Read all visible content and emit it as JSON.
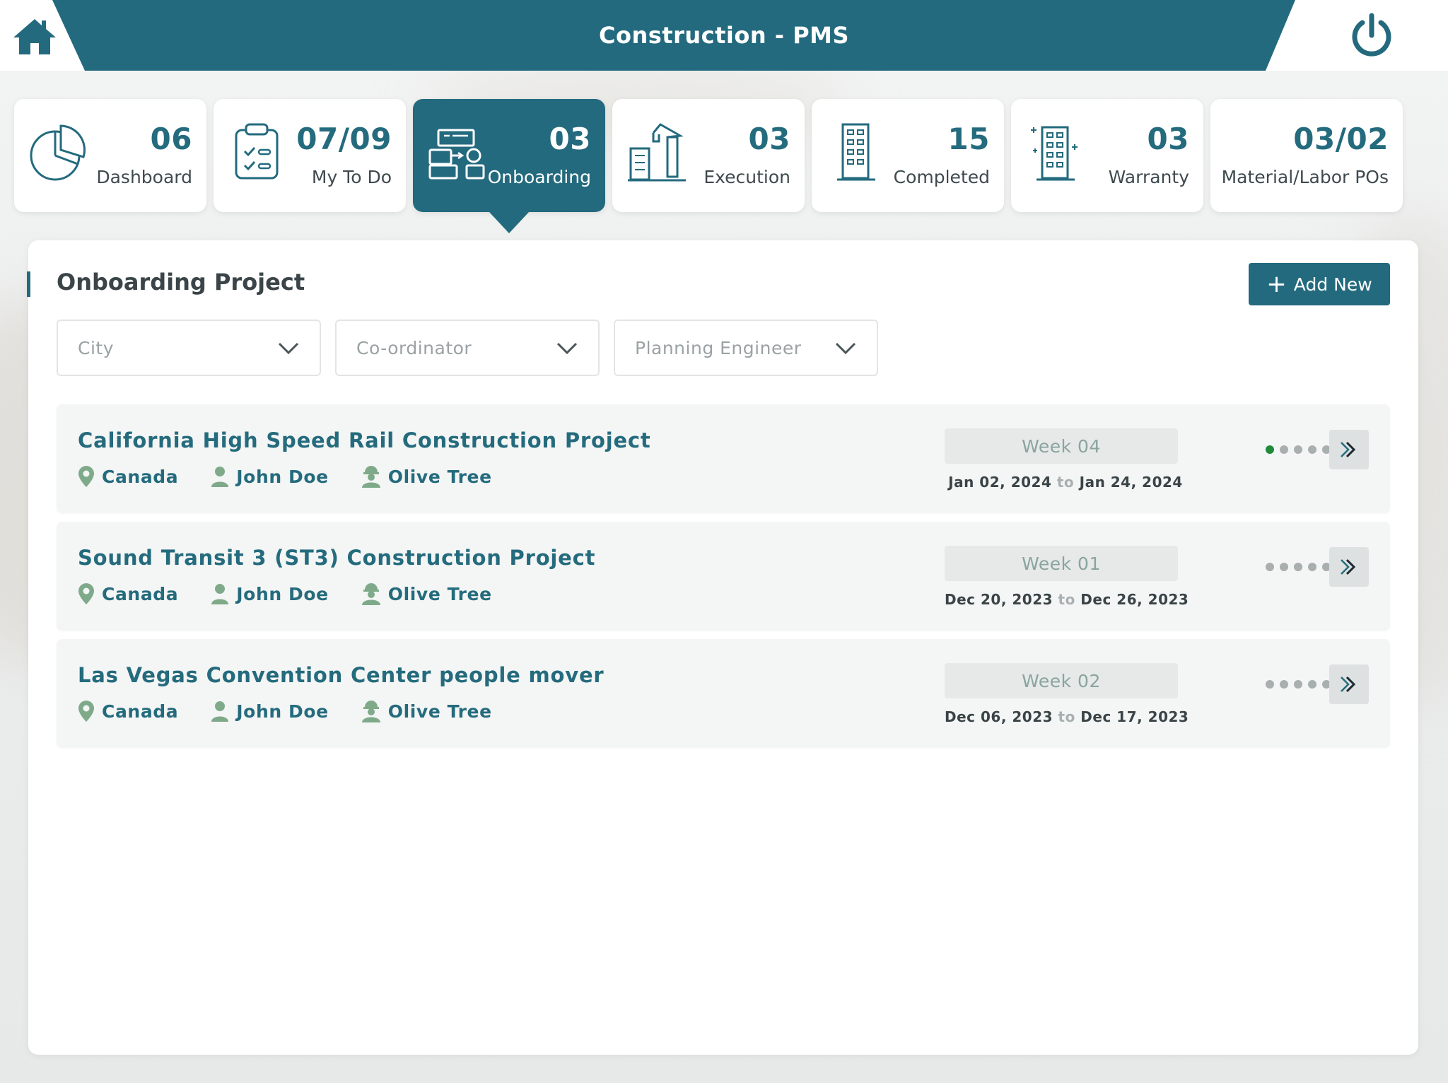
{
  "header": {
    "title": "Construction - PMS",
    "home_icon": "home-icon",
    "power_icon": "power-icon"
  },
  "tabs": [
    {
      "key": "dashboard",
      "count": "06",
      "label": "Dashboard",
      "icon": "pie-chart-icon",
      "active": false
    },
    {
      "key": "todo",
      "count": "07/09",
      "label": "My To Do",
      "icon": "clipboard-checklist-icon",
      "active": false
    },
    {
      "key": "onboarding",
      "count": "03",
      "label": "Onboarding",
      "icon": "onboarding-workflow-icon",
      "active": true
    },
    {
      "key": "execution",
      "count": "03",
      "label": "Execution",
      "icon": "building-crane-icon",
      "active": false
    },
    {
      "key": "completed",
      "count": "15",
      "label": "Completed",
      "icon": "building-icon",
      "active": false
    },
    {
      "key": "warranty",
      "count": "03",
      "label": "Warranty",
      "icon": "building-sparkle-icon",
      "active": false
    },
    {
      "key": "pos",
      "count": "03/02",
      "label": "Material/Labor POs",
      "icon": "",
      "active": false
    }
  ],
  "panel": {
    "title": "Onboarding Project",
    "add_button": "Add New"
  },
  "filters": {
    "city": "City",
    "coordinator": "Co-ordinator",
    "planning_engineer": "Planning Engineer"
  },
  "projects": [
    {
      "name": "California High Speed Rail Construction Project",
      "city": "Canada",
      "coordinator": "John Doe",
      "engineer": "Olive Tree",
      "week": "Week 04",
      "start": "Jan 02, 2024",
      "to": "to",
      "end": "Jan 24, 2024",
      "progress_steps_done": 1,
      "progress_steps_total": 5
    },
    {
      "name": "Sound Transit 3 (ST3) Construction Project",
      "city": "Canada",
      "coordinator": "John Doe",
      "engineer": "Olive Tree",
      "week": "Week 01",
      "start": "Dec 20, 2023",
      "to": "to",
      "end": "Dec 26, 2023",
      "progress_steps_done": 0,
      "progress_steps_total": 5
    },
    {
      "name": "Las Vegas Convention Center people mover",
      "city": "Canada",
      "coordinator": "John Doe",
      "engineer": "Olive Tree",
      "week": "Week 02",
      "start": "Dec 06, 2023",
      "to": "to",
      "end": "Dec 17, 2023",
      "progress_steps_done": 0,
      "progress_steps_total": 5
    }
  ],
  "colors": {
    "primary": "#236a7e",
    "active_dot": "#1f8a3a",
    "inactive_dot": "#a9aeaf"
  }
}
